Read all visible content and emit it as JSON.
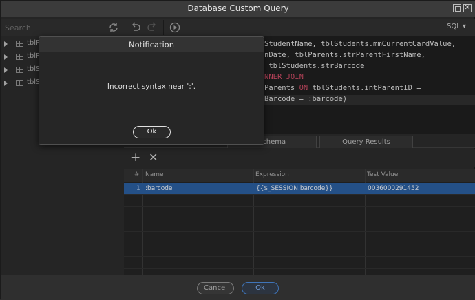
{
  "window": {
    "title": "Database Custom Query"
  },
  "toolbar": {
    "search_placeholder": "Search",
    "sql_label": "SQL ▾"
  },
  "sidebar": {
    "items": [
      {
        "label": "tblP"
      },
      {
        "label": "tblP"
      },
      {
        "label": "tblS"
      },
      {
        "label": "tblS"
      }
    ]
  },
  "editor": {
    "lines": [
      "StudentName, tblStudents.mmCurrentCardValue,",
      "nDate, tblParents.strParentFirstName,",
      " tblStudents.strBarcode",
      "NNER JOIN",
      "Parents ON tblStudents.intParentID =",
      "",
      "Barcode = :barcode)"
    ],
    "kw_inner": "NNER JOIN",
    "kw_on": "ON"
  },
  "tabs": {
    "schema": "Schema",
    "results": "Query Results"
  },
  "params": {
    "add_label": "+",
    "remove_label": "✕",
    "headers": {
      "num": "#",
      "name": "Name",
      "expression": "Expression",
      "test_value": "Test Value"
    },
    "rows": [
      {
        "num": "1",
        "name": ":barcode",
        "expression": "{{$_SESSION.barcode}}",
        "test_value": "0036000291452"
      }
    ]
  },
  "footer": {
    "cancel": "Cancel",
    "ok": "Ok"
  },
  "notification": {
    "title": "Notification",
    "message": "Incorrect syntax near ':'.",
    "ok": "Ok"
  },
  "colors": {
    "accent": "#2a5c9a",
    "keyword": "#c94a63"
  }
}
